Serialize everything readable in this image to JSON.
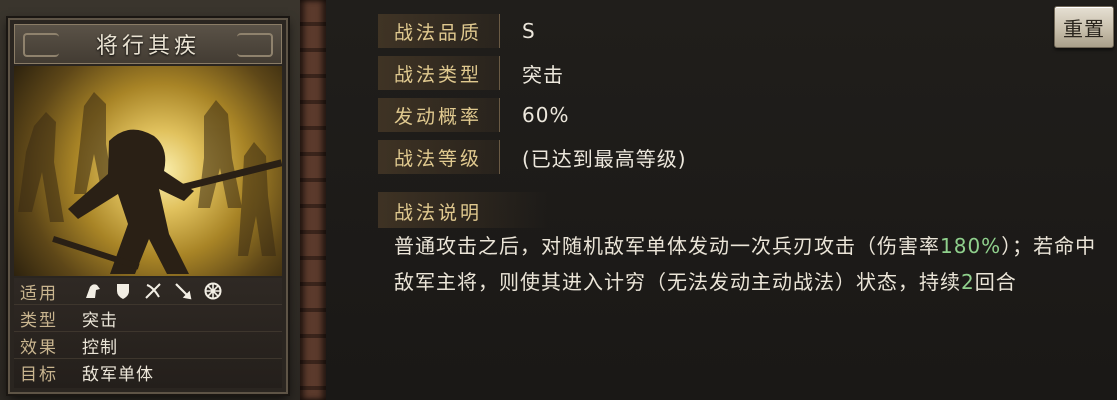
{
  "card": {
    "title": "将行其疾",
    "attributes": [
      {
        "label": "适用",
        "type": "icons",
        "icons": [
          "cavalry-icon",
          "shield-infantry-icon",
          "bow-archer-icon",
          "spear-icon",
          "wheel-siege-icon"
        ]
      },
      {
        "label": "类型",
        "value": "突击"
      },
      {
        "label": "效果",
        "value": "控制"
      },
      {
        "label": "目标",
        "value": "敌军单体"
      }
    ]
  },
  "details": {
    "quality_label": "战法品质",
    "quality_value": "S",
    "type_label": "战法类型",
    "type_value": "突击",
    "chance_label": "发动概率",
    "chance_value": "60%",
    "level_label": "战法等级",
    "level_value": "(已达到最高等级)",
    "desc_label": "战法说明",
    "desc_part1": "普通攻击之后，对随机敌军单体发动一次兵刃攻击（伤害率",
    "desc_highlight1": "180%",
    "desc_part2": "）；若命中敌军主将，则使其进入计穷（无法发动主动战法）状态，持续",
    "desc_highlight2": "2",
    "desc_part3": "回合"
  },
  "reset_label": "重置",
  "colors": {
    "highlight": "#8fd08c",
    "label_gold": "#e0c98f"
  }
}
